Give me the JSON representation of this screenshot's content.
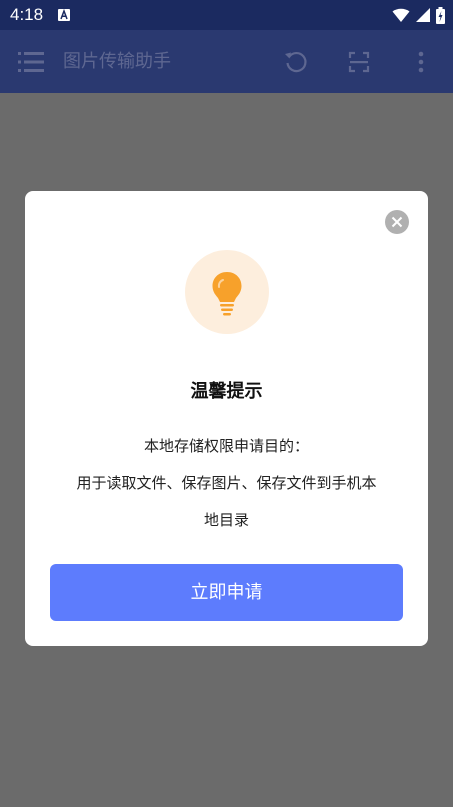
{
  "status_bar": {
    "time": "4:18",
    "icons": [
      "a-icon",
      "wifi-icon",
      "signal-icon",
      "battery-icon"
    ]
  },
  "toolbar": {
    "title": "图片传输助手",
    "icons": [
      "menu-icon",
      "refresh-icon",
      "scan-icon",
      "more-vert-icon"
    ]
  },
  "dialog": {
    "icon": "lightbulb-icon",
    "title": "温馨提示",
    "body_line1": "本地存储权限申请目的：",
    "body_line2": "用于读取文件、保存图片、保存文件到手机本",
    "body_line3": "地目录",
    "button_label": "立即申请",
    "close_icon": "close-icon"
  },
  "colors": {
    "status_bar_bg": "#1b2a60",
    "toolbar_bg": "#2a3970",
    "overlay_bg": "#6b6b6b",
    "accent_button": "#5d7cfd",
    "icon_circle_bg": "#fdeedd",
    "bulb_orange": "#f7a12b"
  }
}
